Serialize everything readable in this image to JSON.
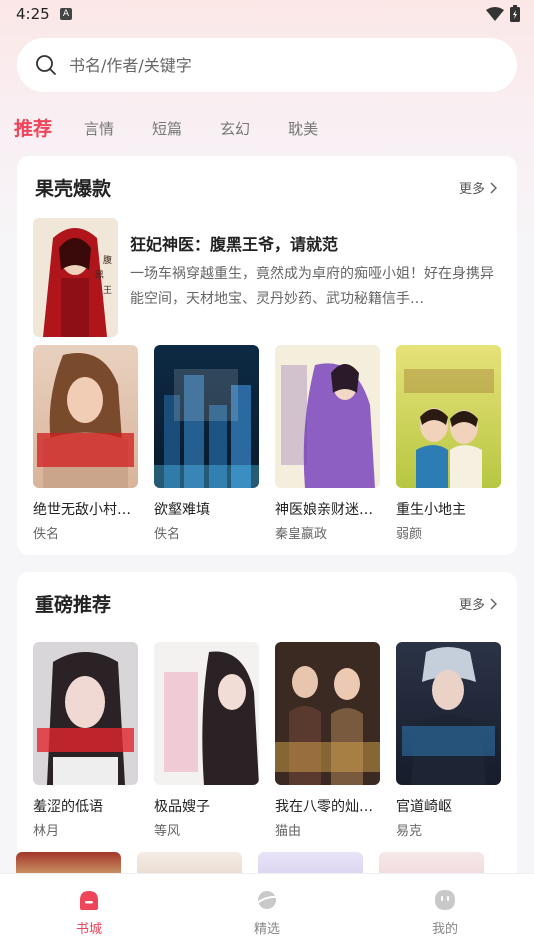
{
  "status": {
    "time": "4:25"
  },
  "search": {
    "placeholder": "书名/作者/关键字"
  },
  "tabs": [
    "推荐",
    "言情",
    "短篇",
    "玄幻",
    "耽美"
  ],
  "section1": {
    "title": "果壳爆款",
    "more": "更多",
    "feature": {
      "title": "狂妃神医：腹黑王爷，请就范",
      "desc": "一场车祸穿越重生，竟然成为卓府的痴哑小姐！好在身携异能空间，天材地宝、灵丹妙药、武功秘籍信手…"
    },
    "books": [
      {
        "title": "绝世无敌小村…",
        "author": "佚名"
      },
      {
        "title": "欲壑难填",
        "author": "佚名"
      },
      {
        "title": "神医娘亲财迷…",
        "author": "秦皇嬴政"
      },
      {
        "title": "重生小地主",
        "author": "弱颜"
      }
    ]
  },
  "section2": {
    "title": "重磅推荐",
    "more": "更多",
    "books": [
      {
        "title": "羞涩的低语",
        "author": "林月"
      },
      {
        "title": "极品嫂子",
        "author": "等风"
      },
      {
        "title": "我在八零的灿…",
        "author": "猫由"
      },
      {
        "title": "官道崎岖",
        "author": "易克"
      }
    ]
  },
  "nav": [
    {
      "label": "书城",
      "icon": "bookstore-icon"
    },
    {
      "label": "精选",
      "icon": "planet-icon"
    },
    {
      "label": "我的",
      "icon": "profile-icon"
    }
  ],
  "colors": {
    "accent": "#f0445a"
  }
}
